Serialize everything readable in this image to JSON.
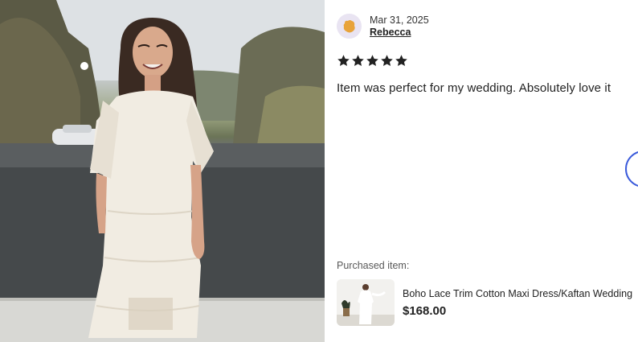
{
  "photo": {
    "alt_icon": "review-photo"
  },
  "reviewer": {
    "avatar_icon": "avatar-blob-icon",
    "date": "Mar 31, 2025",
    "name": "Rebecca"
  },
  "rating": {
    "stars": 5,
    "max": 5,
    "star_color": "#222222"
  },
  "review_text": "Item was perfect for my wedding. Absolutely love it",
  "purchased": {
    "label": "Purchased item:",
    "title": "Boho Lace Trim Cotton Maxi Dress/Kaftan Wedding ...",
    "price": "$168.00"
  },
  "colors": {
    "nav_ring": "#3b5bdb",
    "avatar_bg": "#e9e4f2",
    "avatar_blob": "#e8a33a"
  }
}
